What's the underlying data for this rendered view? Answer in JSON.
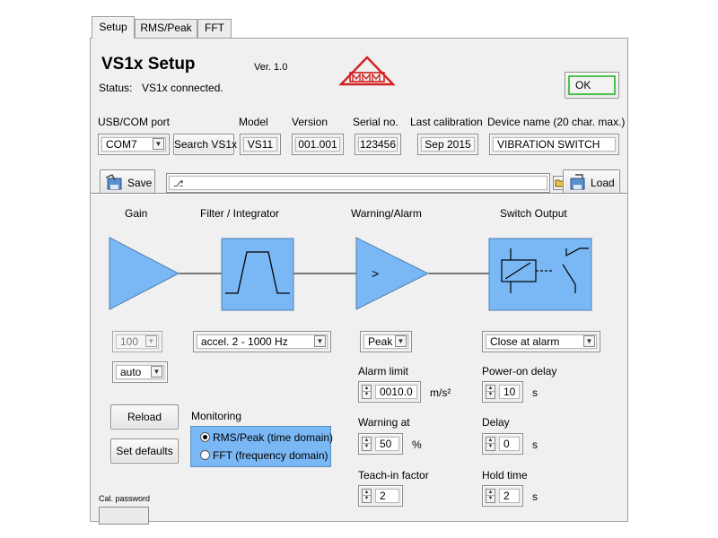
{
  "tabs": [
    "Setup",
    "RMS/Peak",
    "FFT"
  ],
  "header": {
    "title": "VS1x Setup",
    "version": "Ver. 1.0",
    "status_label": "Status:",
    "status_value": "VS1x connected.",
    "ok_label": "OK"
  },
  "device": {
    "port_label": "USB/COM port",
    "port_value": "COM7",
    "search_label": "Search VS1x",
    "model_label": "Model",
    "model_value": "VS11",
    "version_label": "Version",
    "version_value": "001.001",
    "serial_label": "Serial no.",
    "serial_value": "123456",
    "calibration_label": "Last calibration",
    "calibration_value": "Sep  2015",
    "name_label": "Device name (20 char. max.)",
    "name_value": "VIBRATION SWITCH"
  },
  "file": {
    "save_label": "Save",
    "path_value": "",
    "load_label": "Load"
  },
  "sections": {
    "gain": "Gain",
    "filter": "Filter / Integrator",
    "warning": "Warning/Alarm",
    "switch": "Switch Output"
  },
  "comparator_symbol": ">",
  "gain": {
    "value": "100",
    "mode": "auto"
  },
  "filter": {
    "value": "accel.  2 - 1000 Hz"
  },
  "alarm": {
    "mode": "Peak",
    "limit_label": "Alarm limit",
    "limit_value": "0010.0",
    "limit_unit": "m/s²",
    "warning_label": "Warning at",
    "warning_value": "50",
    "warning_unit": "%",
    "teach_label": "Teach-in factor",
    "teach_value": "2"
  },
  "switch": {
    "mode": "Close at alarm",
    "power_on_label": "Power-on delay",
    "power_on_value": "10",
    "delay_label": "Delay",
    "delay_value": "0",
    "hold_label": "Hold time",
    "hold_value": "2",
    "unit": "s"
  },
  "buttons": {
    "reload": "Reload",
    "defaults": "Set defaults"
  },
  "monitoring": {
    "label": "Monitoring",
    "options": [
      "RMS/Peak (time domain)",
      "FFT (frequency domain)"
    ],
    "selected_index": 0
  },
  "cal_password": {
    "label": "Cal. password",
    "value": ""
  },
  "colors": {
    "block_fill": "#7ab8f5",
    "ok_border": "#4ec24e",
    "logo_red": "#d42020"
  }
}
